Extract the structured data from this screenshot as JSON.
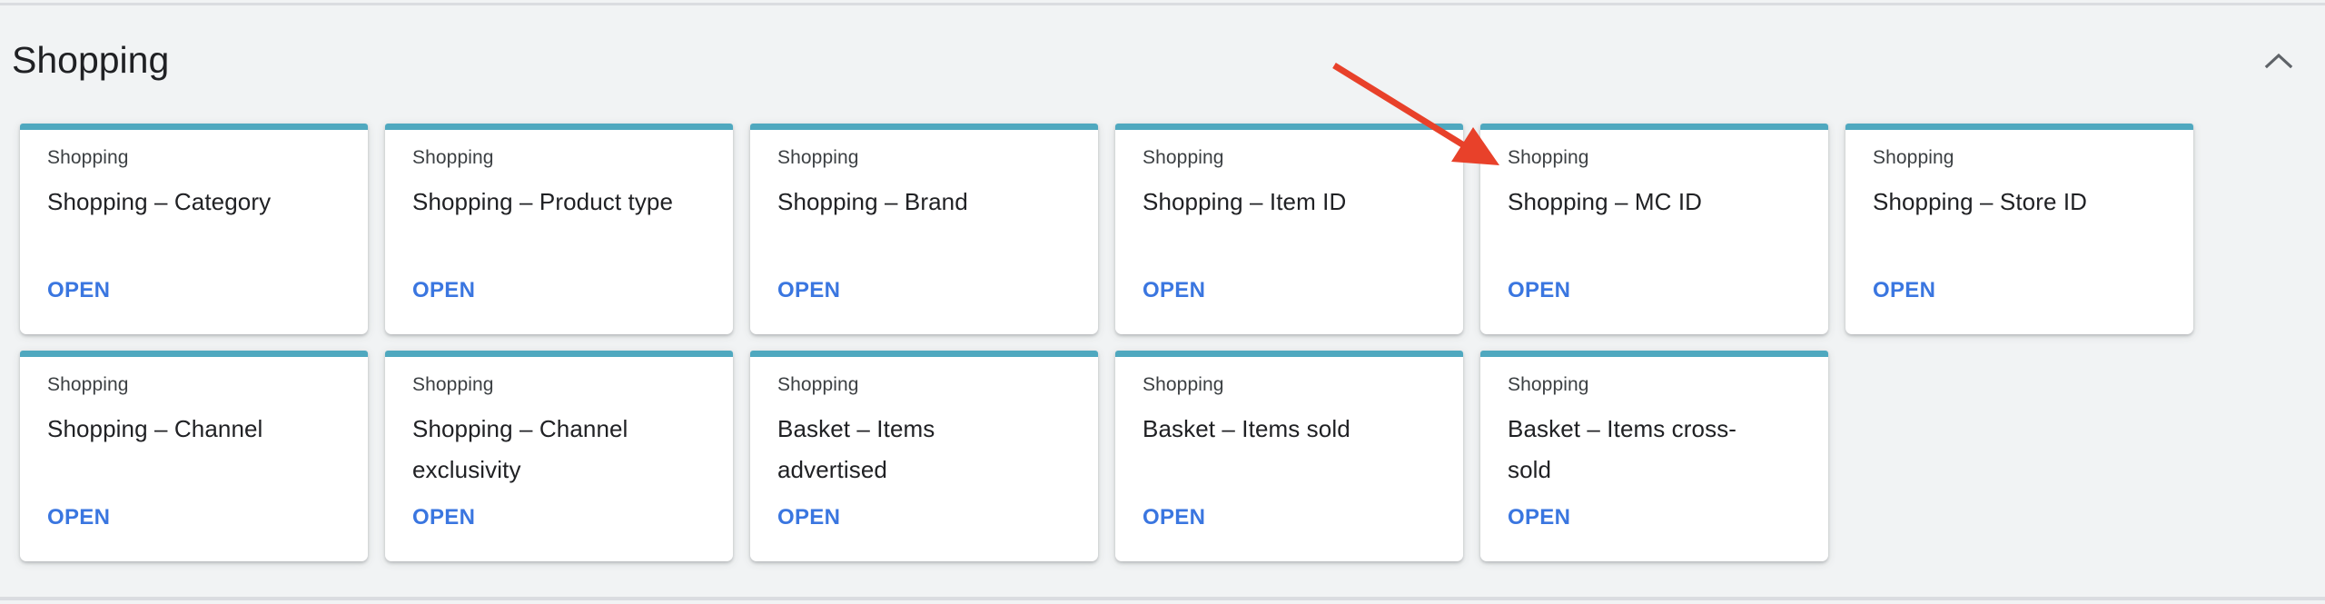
{
  "section": {
    "title": "Shopping",
    "collapse_icon": "chevron-up-icon"
  },
  "cards": [
    {
      "category": "Shopping",
      "title": "Shopping – Category",
      "action": "OPEN"
    },
    {
      "category": "Shopping",
      "title": "Shopping – Product type",
      "action": "OPEN"
    },
    {
      "category": "Shopping",
      "title": "Shopping – Brand",
      "action": "OPEN"
    },
    {
      "category": "Shopping",
      "title": "Shopping – Item ID",
      "action": "OPEN"
    },
    {
      "category": "Shopping",
      "title": "Shopping – MC ID",
      "action": "OPEN"
    },
    {
      "category": "Shopping",
      "title": "Shopping – Store ID",
      "action": "OPEN"
    },
    {
      "category": "Shopping",
      "title": "Shopping – Channel",
      "action": "OPEN"
    },
    {
      "category": "Shopping",
      "title": "Shopping – Channel exclusivity",
      "action": "OPEN"
    },
    {
      "category": "Shopping",
      "title": "Basket – Items advertised",
      "action": "OPEN"
    },
    {
      "category": "Shopping",
      "title": "Basket – Items sold",
      "action": "OPEN"
    },
    {
      "category": "Shopping",
      "title": "Basket – Items cross-sold",
      "action": "OPEN"
    }
  ],
  "annotation": {
    "type": "arrow",
    "points_to": "Shopping – MC ID",
    "color": "#e8412a"
  },
  "colors": {
    "card_accent": "#4fa8bf",
    "link": "#3a76e0",
    "background": "#f1f3f4"
  }
}
